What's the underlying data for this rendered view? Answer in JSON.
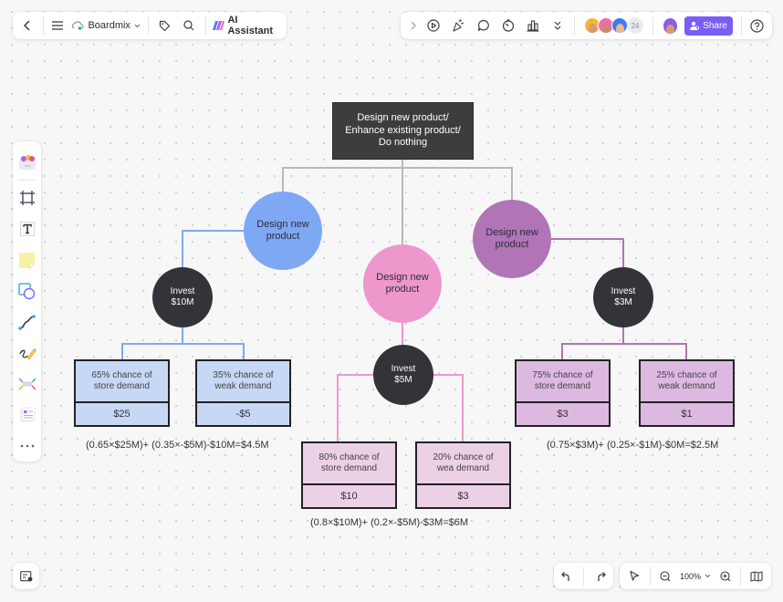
{
  "toolbar_left": {
    "back_icon": "chevron-left-icon",
    "menu_icon": "hamburger-menu-icon",
    "cloud_icon": "cloud-saved-icon",
    "brand": "Boardmix",
    "tag_icon": "tag-icon",
    "search_icon": "search-icon",
    "ai_label": "AI Assistant"
  },
  "toolbar_right": {
    "collaborator_count": "24",
    "share_label": "Share",
    "icons": [
      "chevron-right-icon",
      "play-icon",
      "celebrate-icon",
      "comment-icon",
      "timer-icon",
      "vote-icon",
      "more-chevrons-icon",
      "help-icon"
    ]
  },
  "left_tools": [
    "templates",
    "frame",
    "text",
    "sticky-note",
    "shape",
    "connector",
    "pen",
    "mind-map",
    "layout",
    "more"
  ],
  "bottom": {
    "zoom_level": "100%"
  },
  "diagram": {
    "root": "Design new product/\nEnhance existing product/\nDo nothing",
    "branches": [
      {
        "label": "Design new\nproduct",
        "color": "#7ea8f3",
        "line_color": "#7ea8f3",
        "invest": "Invest\n$10M",
        "outcomes": [
          {
            "chance": "65% chance of\nstore demand",
            "value": "$25"
          },
          {
            "chance": "35% chance of\nweak demand",
            "value": "-$5"
          }
        ],
        "formula": "(0.65×$25M)+  (0.35×-$5M)-$10M=$4.5M"
      },
      {
        "label": "Design new\nproduct",
        "color": "#ee97cd",
        "line_color": "#ee97cd",
        "invest": "Invest\n$5M",
        "outcomes": [
          {
            "chance": "80% chance of\nstore demand",
            "value": "$10"
          },
          {
            "chance": "20% chance of\nwea demand",
            "value": "$3"
          }
        ],
        "formula": "(0.8×$10M)+  (0.2×-$5M)-$3M=$6M"
      },
      {
        "label": "Design new\nproduct",
        "color": "#b074b7",
        "line_color": "#b074b7",
        "invest": "Invest\n$3M",
        "outcomes": [
          {
            "chance": "75% chance of\nstore demand",
            "value": "$3"
          },
          {
            "chance": "25% chance of\nweak demand",
            "value": "$1"
          }
        ],
        "formula": "(0.75×$3M)+  (0.25×-$1M)-$0M=$2.5M"
      }
    ]
  }
}
